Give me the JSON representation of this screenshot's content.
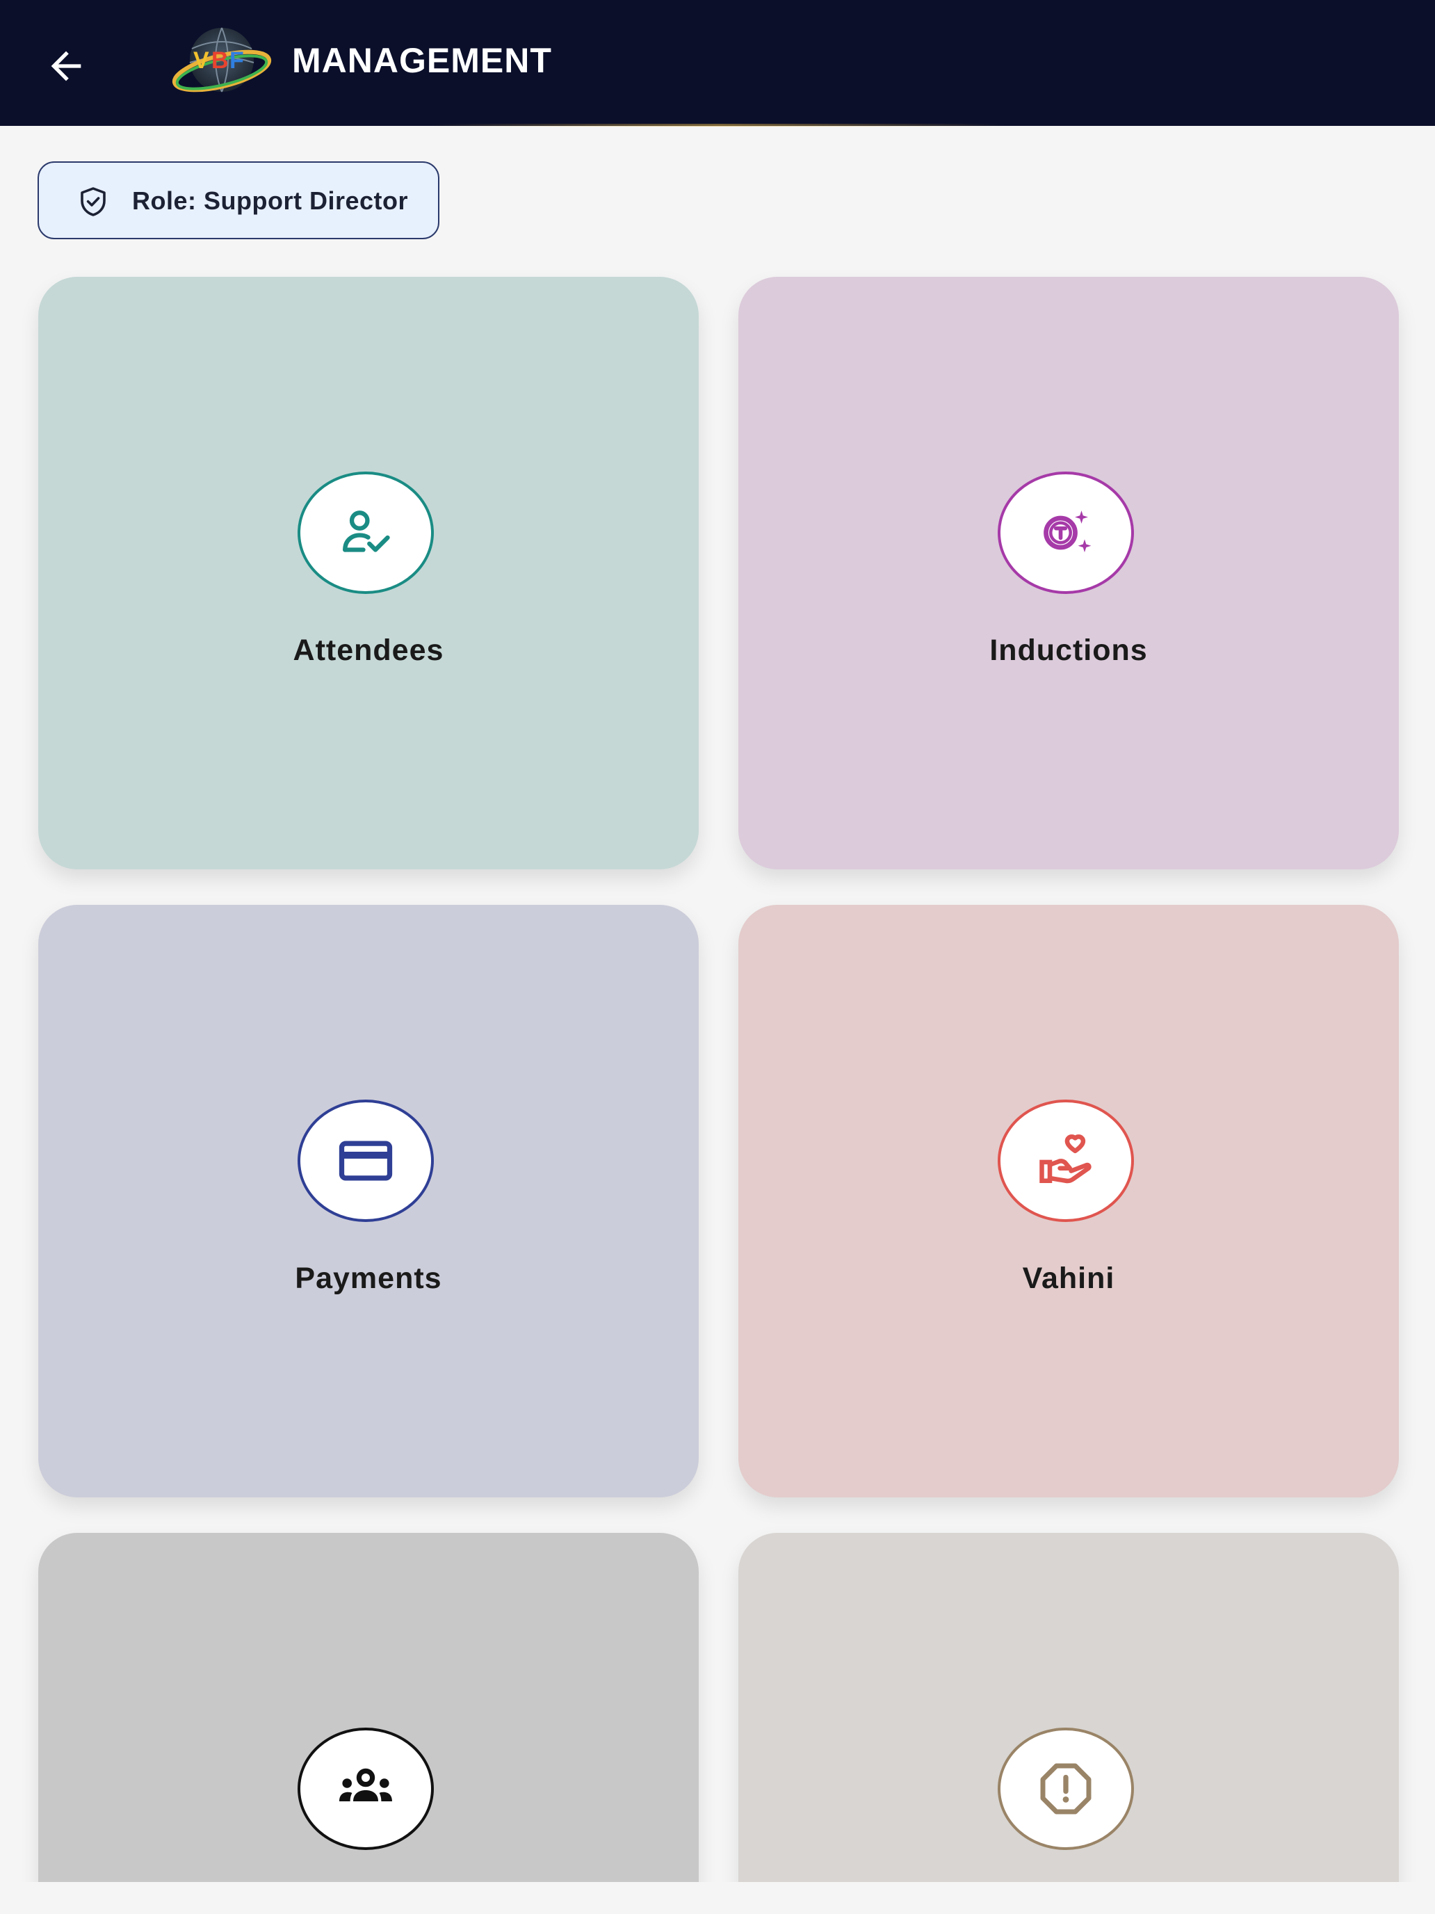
{
  "header": {
    "title": "MANAGEMENT",
    "back_icon": "arrow-left-icon",
    "logo_text": "VBF",
    "background_color": "#0b0f2a"
  },
  "role": {
    "label": "Role: Support Director",
    "icon": "shield-check-icon"
  },
  "cards": [
    {
      "label": "Attendees",
      "icon": "person-check-icon",
      "color": "#1a8c84",
      "background": "#c5d8d6"
    },
    {
      "label": "Inductions",
      "icon": "token-sparkle-icon",
      "color": "#a63aa8",
      "background": "#dccbdb"
    },
    {
      "label": "Payments",
      "icon": "credit-card-icon",
      "color": "#2f3f95",
      "background": "#cccdda"
    },
    {
      "label": "Vahini",
      "icon": "hand-heart-icon",
      "color": "#e0554f",
      "background": "#e4cccc"
    },
    {
      "label": "",
      "icon": "group-icon",
      "color": "#111111",
      "background": "#c8c8c8"
    },
    {
      "label": "",
      "icon": "alert-octagon-icon",
      "color": "#9a8467",
      "background": "#d8d5d2"
    }
  ]
}
